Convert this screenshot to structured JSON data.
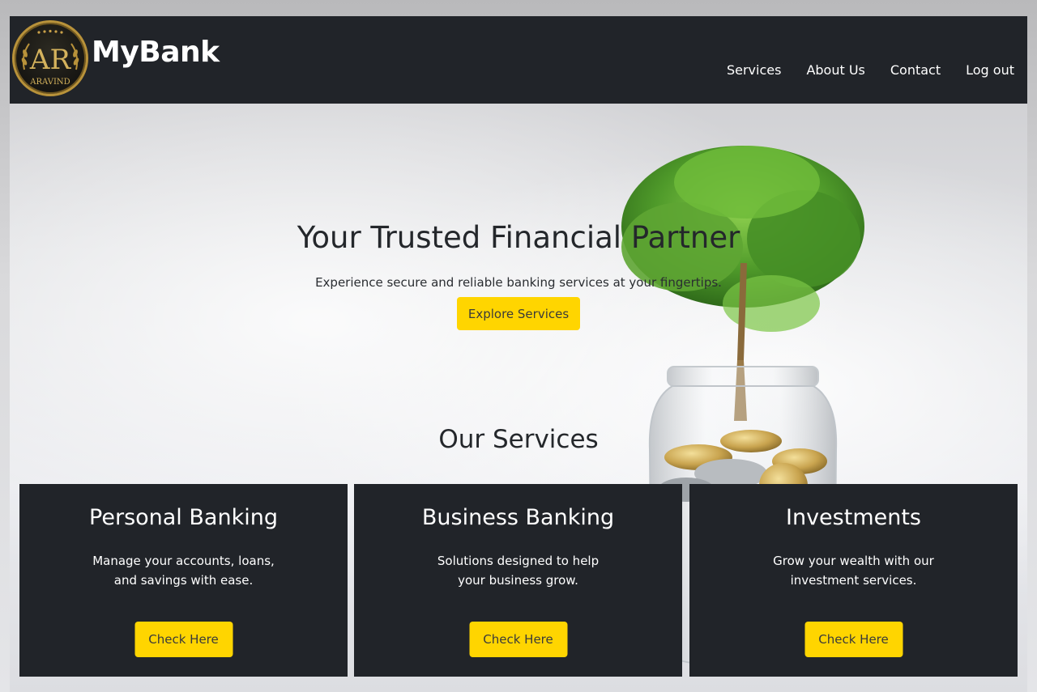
{
  "navbar": {
    "logo_text": "AR",
    "logo_sub": "ARAVIND",
    "brand": "MyBank",
    "links": [
      "Services",
      "About Us",
      "Contact",
      "Log out"
    ]
  },
  "hero": {
    "title": "Your Trusted Financial Partner",
    "subtitle": "Experience secure and reliable banking services at your fingertips.",
    "cta": "Explore Services"
  },
  "services": {
    "heading": "Our Services",
    "cards": [
      {
        "title": "Personal Banking",
        "desc": "Manage your accounts, loans, and savings with ease.",
        "button": "Check Here"
      },
      {
        "title": "Business Banking",
        "desc": "Solutions designed to help your business grow.",
        "button": "Check Here"
      },
      {
        "title": "Investments",
        "desc": "Grow your wealth with our investment services.",
        "button": "Check Here"
      }
    ]
  },
  "colors": {
    "navbar": "#212429",
    "accent": "#ffd500",
    "card": "#212429",
    "logo_gold": "#b8923a"
  }
}
